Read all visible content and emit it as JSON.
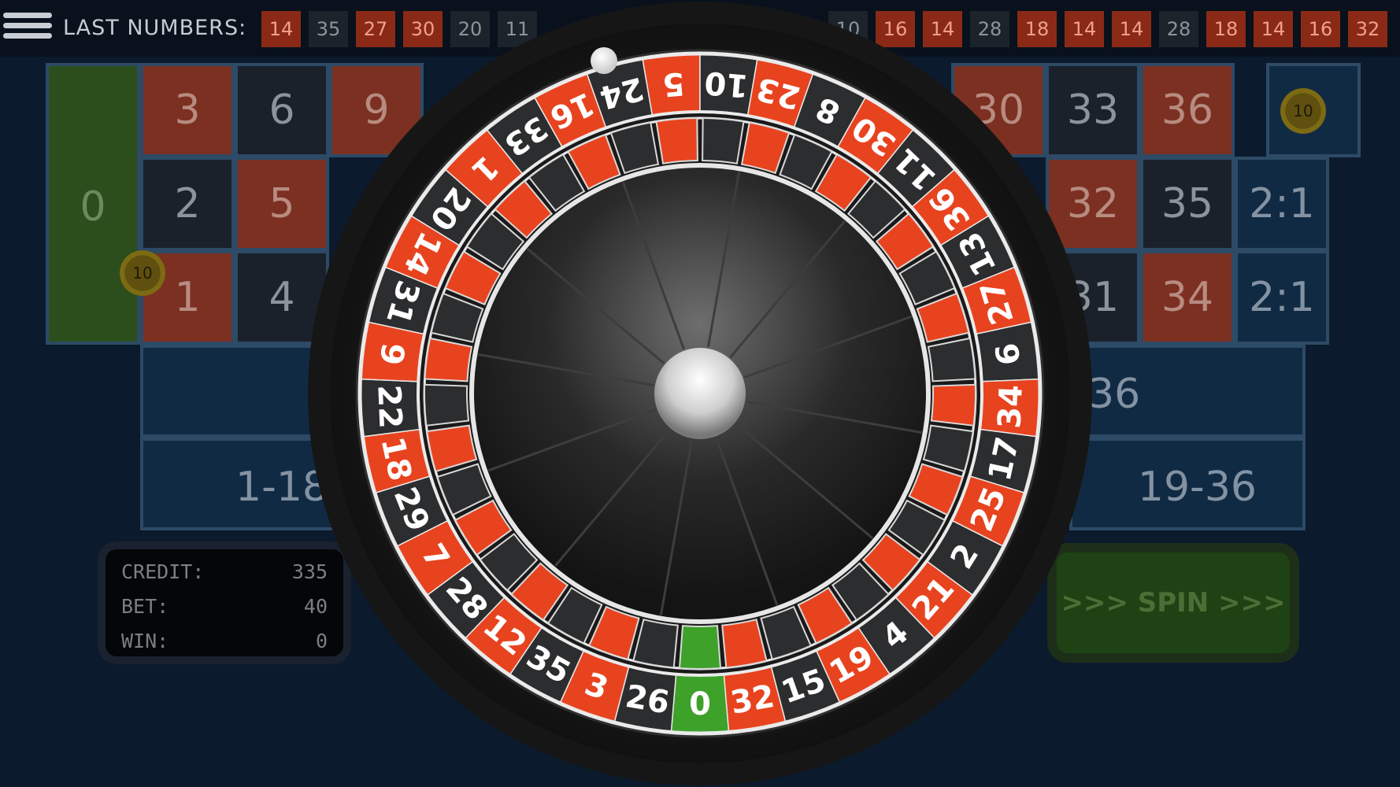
{
  "header": {
    "menu_icon": "hamburger-menu-icon",
    "last_label": "LAST NUMBERS:",
    "last_numbers": [
      {
        "n": "14",
        "c": "red"
      },
      {
        "n": "35",
        "c": "black"
      },
      {
        "n": "27",
        "c": "red"
      },
      {
        "n": "30",
        "c": "red"
      },
      {
        "n": "20",
        "c": "black"
      },
      {
        "n": "11",
        "c": "black"
      },
      {
        "n": "10",
        "c": "black"
      },
      {
        "n": "16",
        "c": "red"
      },
      {
        "n": "14",
        "c": "red"
      },
      {
        "n": "28",
        "c": "black"
      },
      {
        "n": "18",
        "c": "red"
      },
      {
        "n": "14",
        "c": "red"
      },
      {
        "n": "14",
        "c": "red"
      },
      {
        "n": "28",
        "c": "black"
      },
      {
        "n": "18",
        "c": "red"
      },
      {
        "n": "14",
        "c": "red"
      },
      {
        "n": "16",
        "c": "red"
      },
      {
        "n": "32",
        "c": "red"
      }
    ]
  },
  "table": {
    "zero": "0",
    "cells_left": [
      {
        "n": "3",
        "c": "red"
      },
      {
        "n": "6",
        "c": "black"
      },
      {
        "n": "9",
        "c": "red"
      },
      {
        "n": "2",
        "c": "black"
      },
      {
        "n": "5",
        "c": "red"
      },
      {
        "n": "1",
        "c": "red"
      },
      {
        "n": "4",
        "c": "black"
      }
    ],
    "cells_right": [
      {
        "n": "30",
        "c": "red"
      },
      {
        "n": "33",
        "c": "black"
      },
      {
        "n": "36",
        "c": "red"
      },
      {
        "n": "32",
        "c": "red"
      },
      {
        "n": "35",
        "c": "black"
      },
      {
        "n": "2:1",
        "c": "blue"
      },
      {
        "n": "31",
        "c": "black"
      },
      {
        "n": "34",
        "c": "red"
      },
      {
        "n": "2:1",
        "c": "blue"
      }
    ],
    "dozen_left": "1",
    "dozen_right": "36",
    "low": "1-18",
    "high": "19-36",
    "chip_value": "10"
  },
  "status": {
    "credit_label": "CREDIT:",
    "credit_value": "335",
    "bet_label": "BET:",
    "bet_value": "40",
    "win_label": "WIN:",
    "win_value": "0"
  },
  "spin_label": ">>> SPIN >>>",
  "wheel": {
    "numbers_clockwise_from_zero": [
      "0",
      "26",
      "3",
      "35",
      "12",
      "28",
      "7",
      "29",
      "18",
      "22",
      "9",
      "31",
      "14",
      "20",
      "1",
      "33",
      "16",
      "24",
      "5",
      "10",
      "23",
      "8",
      "30",
      "11",
      "36",
      "13",
      "27",
      "6",
      "34",
      "17",
      "25",
      "2",
      "21",
      "4",
      "19",
      "15",
      "32"
    ],
    "colors": {
      "red": "#e8431f",
      "black": "#2c2d2f",
      "green": "#3ea12a"
    }
  }
}
